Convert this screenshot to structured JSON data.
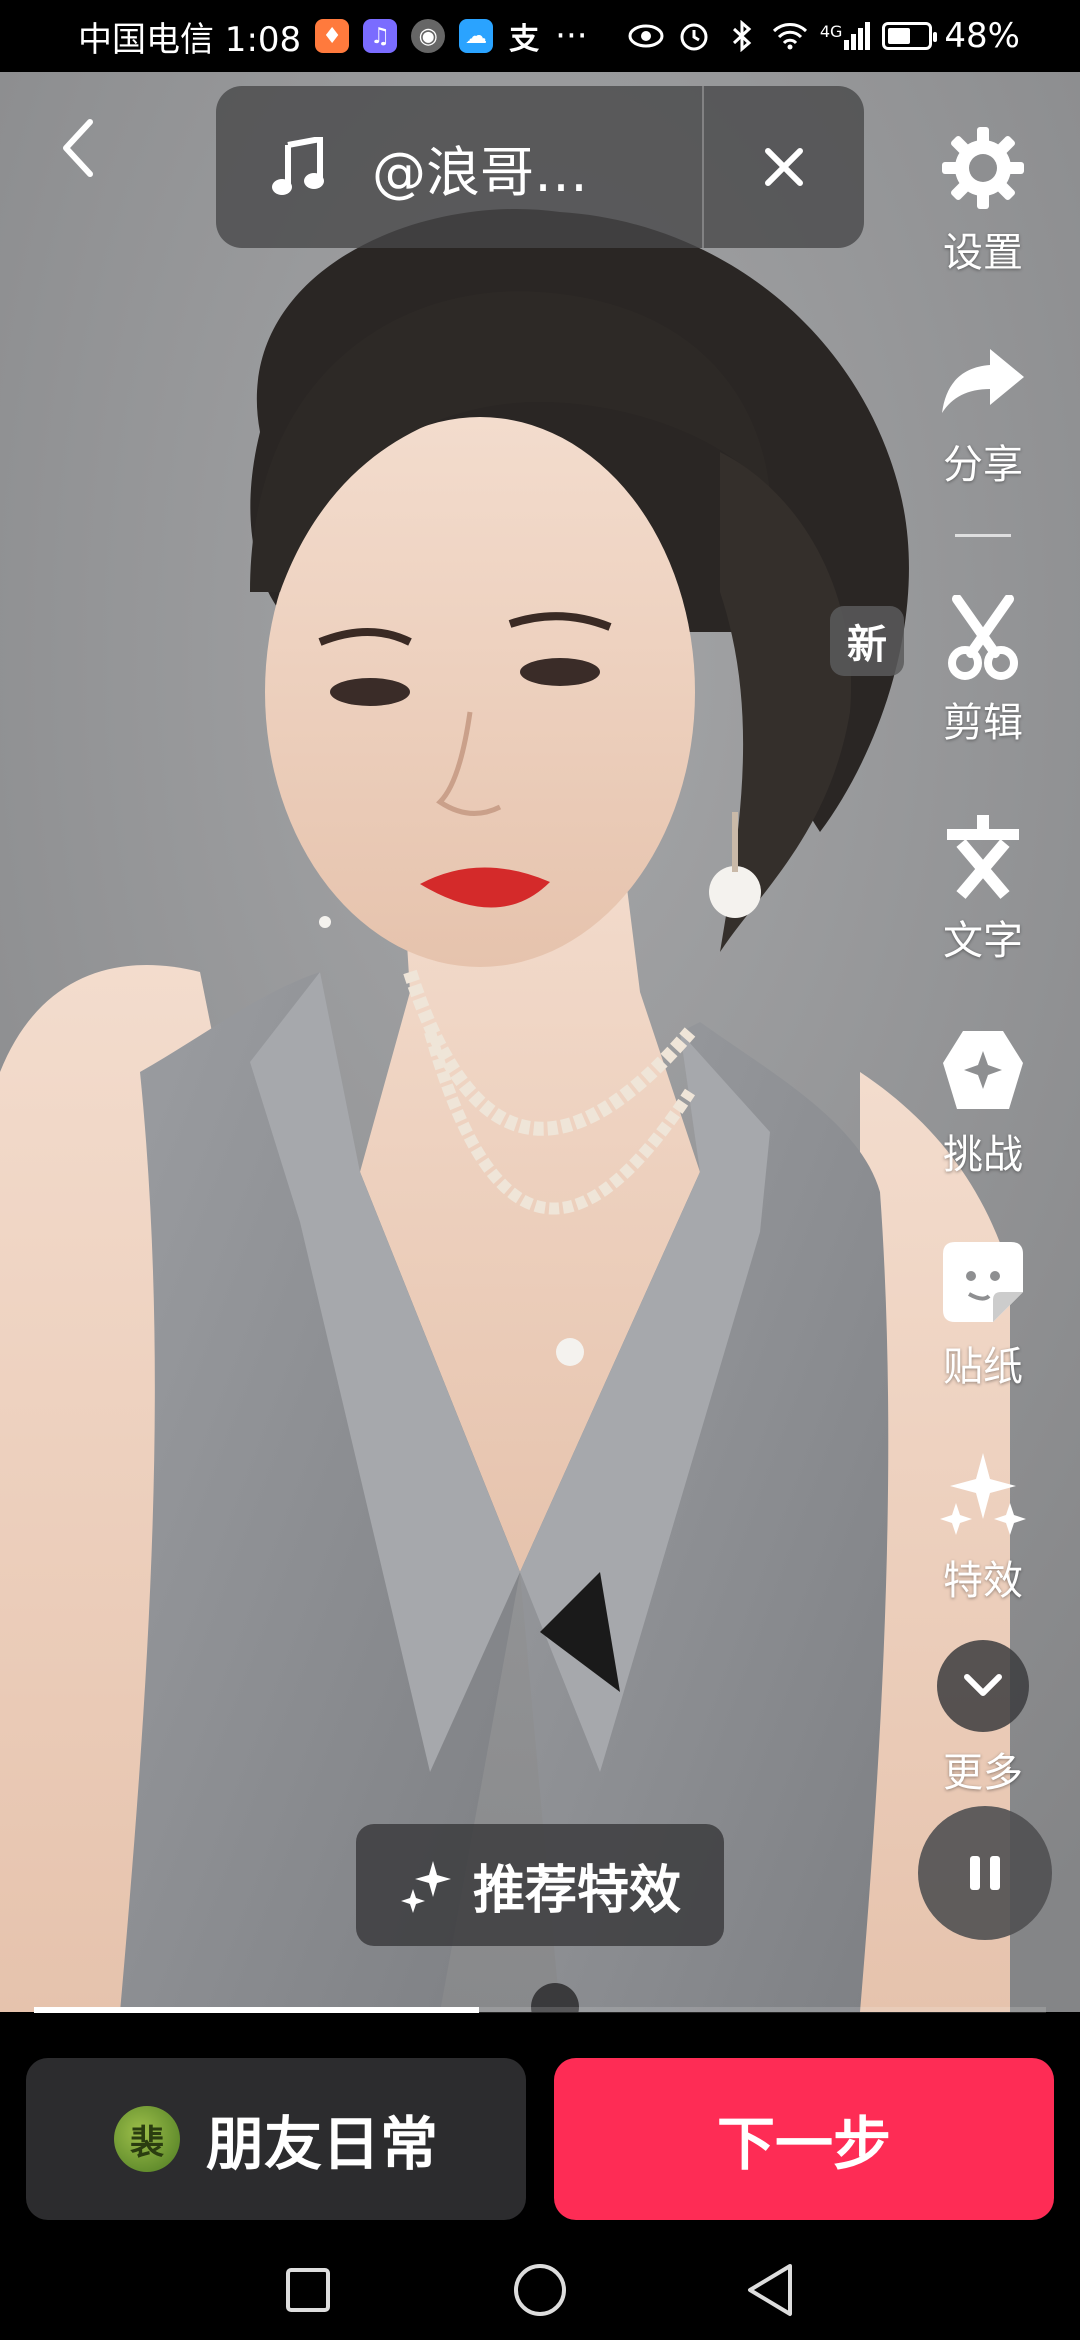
{
  "status_bar": {
    "carrier_time": "中国电信 1:08",
    "overflow": "···",
    "network": "4G",
    "battery": "48%",
    "battery_level": 0.48
  },
  "music": {
    "title": "@浪哥…",
    "note_icon": "music-note-icon",
    "close_icon": "close-icon"
  },
  "toolbar": {
    "settings": "设置",
    "share": "分享",
    "edit": "剪辑",
    "new_badge": "新",
    "text": "文字",
    "challenge": "挑战",
    "sticker": "贴纸",
    "effects": "特效",
    "more": "更多"
  },
  "recommend": {
    "label": "推荐特效"
  },
  "progress": {
    "fraction": 0.44
  },
  "bottom": {
    "friends_label": "朋友日常",
    "avatar_text": "裴",
    "next_label": "下一步"
  },
  "colors": {
    "accent": "#fe2c55",
    "panel": "#2c2c2e"
  }
}
